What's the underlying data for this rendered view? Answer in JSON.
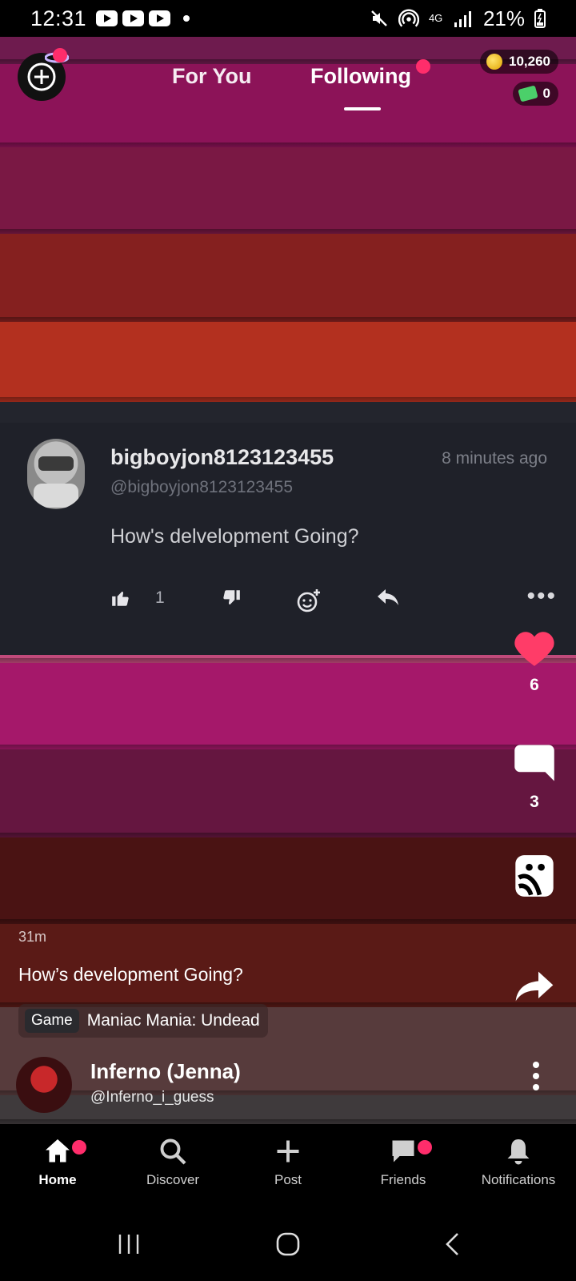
{
  "status_bar": {
    "time": "12:31",
    "battery": "21%",
    "network": "4G"
  },
  "header": {
    "tabs": [
      {
        "label": "For You"
      },
      {
        "label": "Following"
      }
    ],
    "coins": "10,260",
    "cash": "0"
  },
  "comment": {
    "username": "bigboyjon8123123455",
    "handle": "@bigboyjon8123123455",
    "time_ago": "8 minutes ago",
    "text": "How's delvelopment Going?",
    "likes": "1"
  },
  "rail": {
    "likes": "6",
    "comments": "3"
  },
  "post": {
    "time": "31m",
    "title": "How’s development Going?",
    "game_tag": "Game",
    "game_name": "Maniac Mania: Undead",
    "author_name": "Inferno (Jenna)",
    "author_handle": "@Inferno_i_guess"
  },
  "nav": {
    "home": "Home",
    "discover": "Discover",
    "post": "Post",
    "friends": "Friends",
    "notifications": "Notifications"
  },
  "colors": {
    "accent": "#ff2d6b",
    "card": "#1f2129"
  }
}
